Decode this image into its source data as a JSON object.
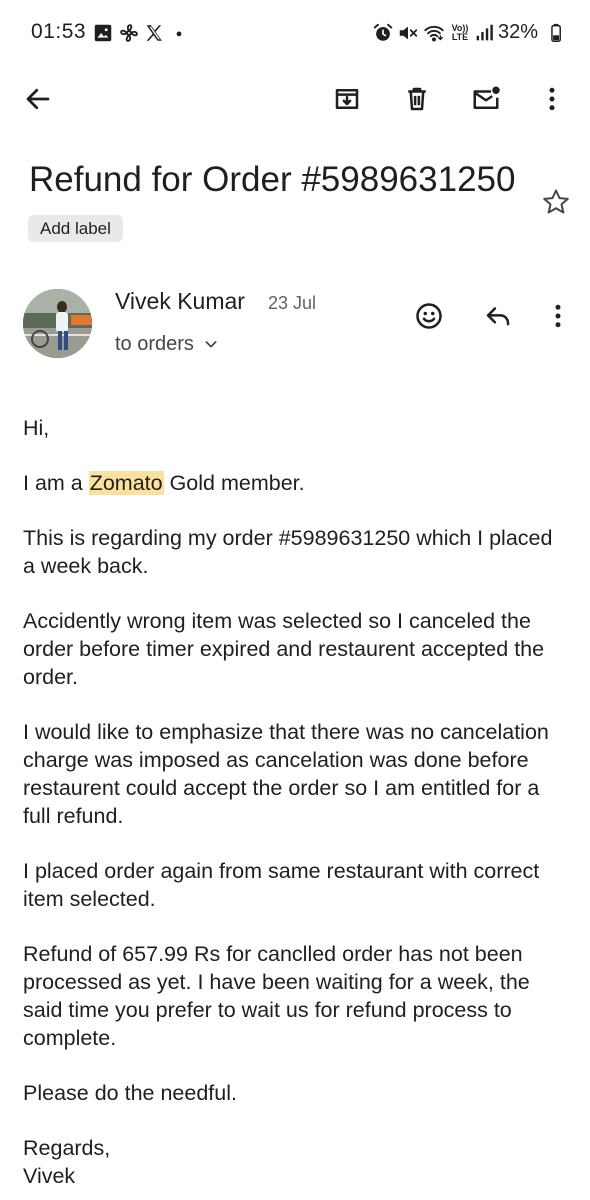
{
  "status_bar": {
    "time": "01:53",
    "battery": "32%",
    "left_icons": [
      "image-icon",
      "fan-icon",
      "x-logo-icon",
      "dot-icon"
    ],
    "right_icons": [
      "alarm-icon",
      "mute-icon",
      "wifi-icon",
      "volte-icon",
      "signal-icon",
      "battery-icon"
    ],
    "volte_top": "Vo))",
    "volte_bottom": "LTE"
  },
  "toolbar": {
    "icons": [
      "back-arrow-icon",
      "archive-icon",
      "delete-icon",
      "mark-unread-icon",
      "more-vert-icon"
    ]
  },
  "email": {
    "subject": "Refund for Order #5989631250",
    "label_button": "Add label",
    "sender": {
      "name": "Vivek Kumar",
      "date": "23 Jul",
      "recipient": "to orders"
    },
    "body": {
      "greeting": "Hi,",
      "p1_before": "I am a ",
      "p1_highlight": "Zomato",
      "p1_after": " Gold member.",
      "p2": "This is regarding my order #5989631250 which I placed a week back.",
      "p3": "Accidently wrong item was selected so I canceled the order before timer expired and restaurent accepted the order.",
      "p4": "I would like to emphasize that there was no cancelation charge was imposed as cancelation was done before restaurent could accept the order so I am entitled for a full refund.",
      "p5": "I placed order again from same restaurant with correct item selected.",
      "p6": "Refund of 657.99 Rs for canclled order has not been processed as yet. I have been waiting for a week, the said time you prefer to wait us for refund process to complete.",
      "p7": "Please do the needful.",
      "closing": "Regards,",
      "signature": "Vivek"
    }
  },
  "colors": {
    "highlight": "#fbe19b",
    "chip_bg": "#e9e9eb",
    "text": "#1f1f1f",
    "secondary_text": "#5f6368"
  }
}
